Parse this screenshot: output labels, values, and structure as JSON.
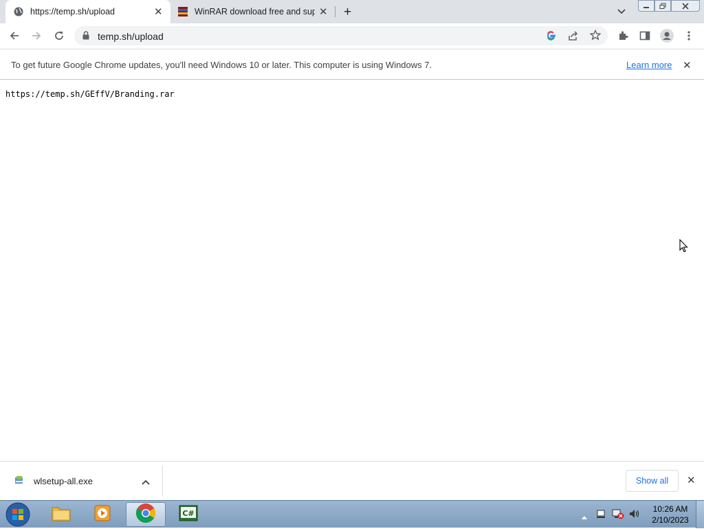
{
  "browser": {
    "tabs": [
      {
        "label": "https://temp.sh/upload",
        "active": true,
        "icon": "globe-icon"
      },
      {
        "label": "WinRAR download free and supp",
        "active": false,
        "icon": "winrar-icon"
      }
    ],
    "address": "temp.sh/upload"
  },
  "infobar": {
    "message": "To get future Google Chrome updates, you'll need Windows 10 or later. This computer is using Windows 7.",
    "link": "Learn more"
  },
  "page": {
    "text": "https://temp.sh/GEffV/Branding.rar"
  },
  "downloads": {
    "filename": "wlsetup-all.exe",
    "show_all": "Show all"
  },
  "taskbar": {
    "time": "10:26 AM",
    "date": "2/10/2023"
  },
  "colors": {
    "accent": "#1a73e8",
    "tabstrip": "#dee1e6",
    "omnibox": "#f1f3f4"
  }
}
